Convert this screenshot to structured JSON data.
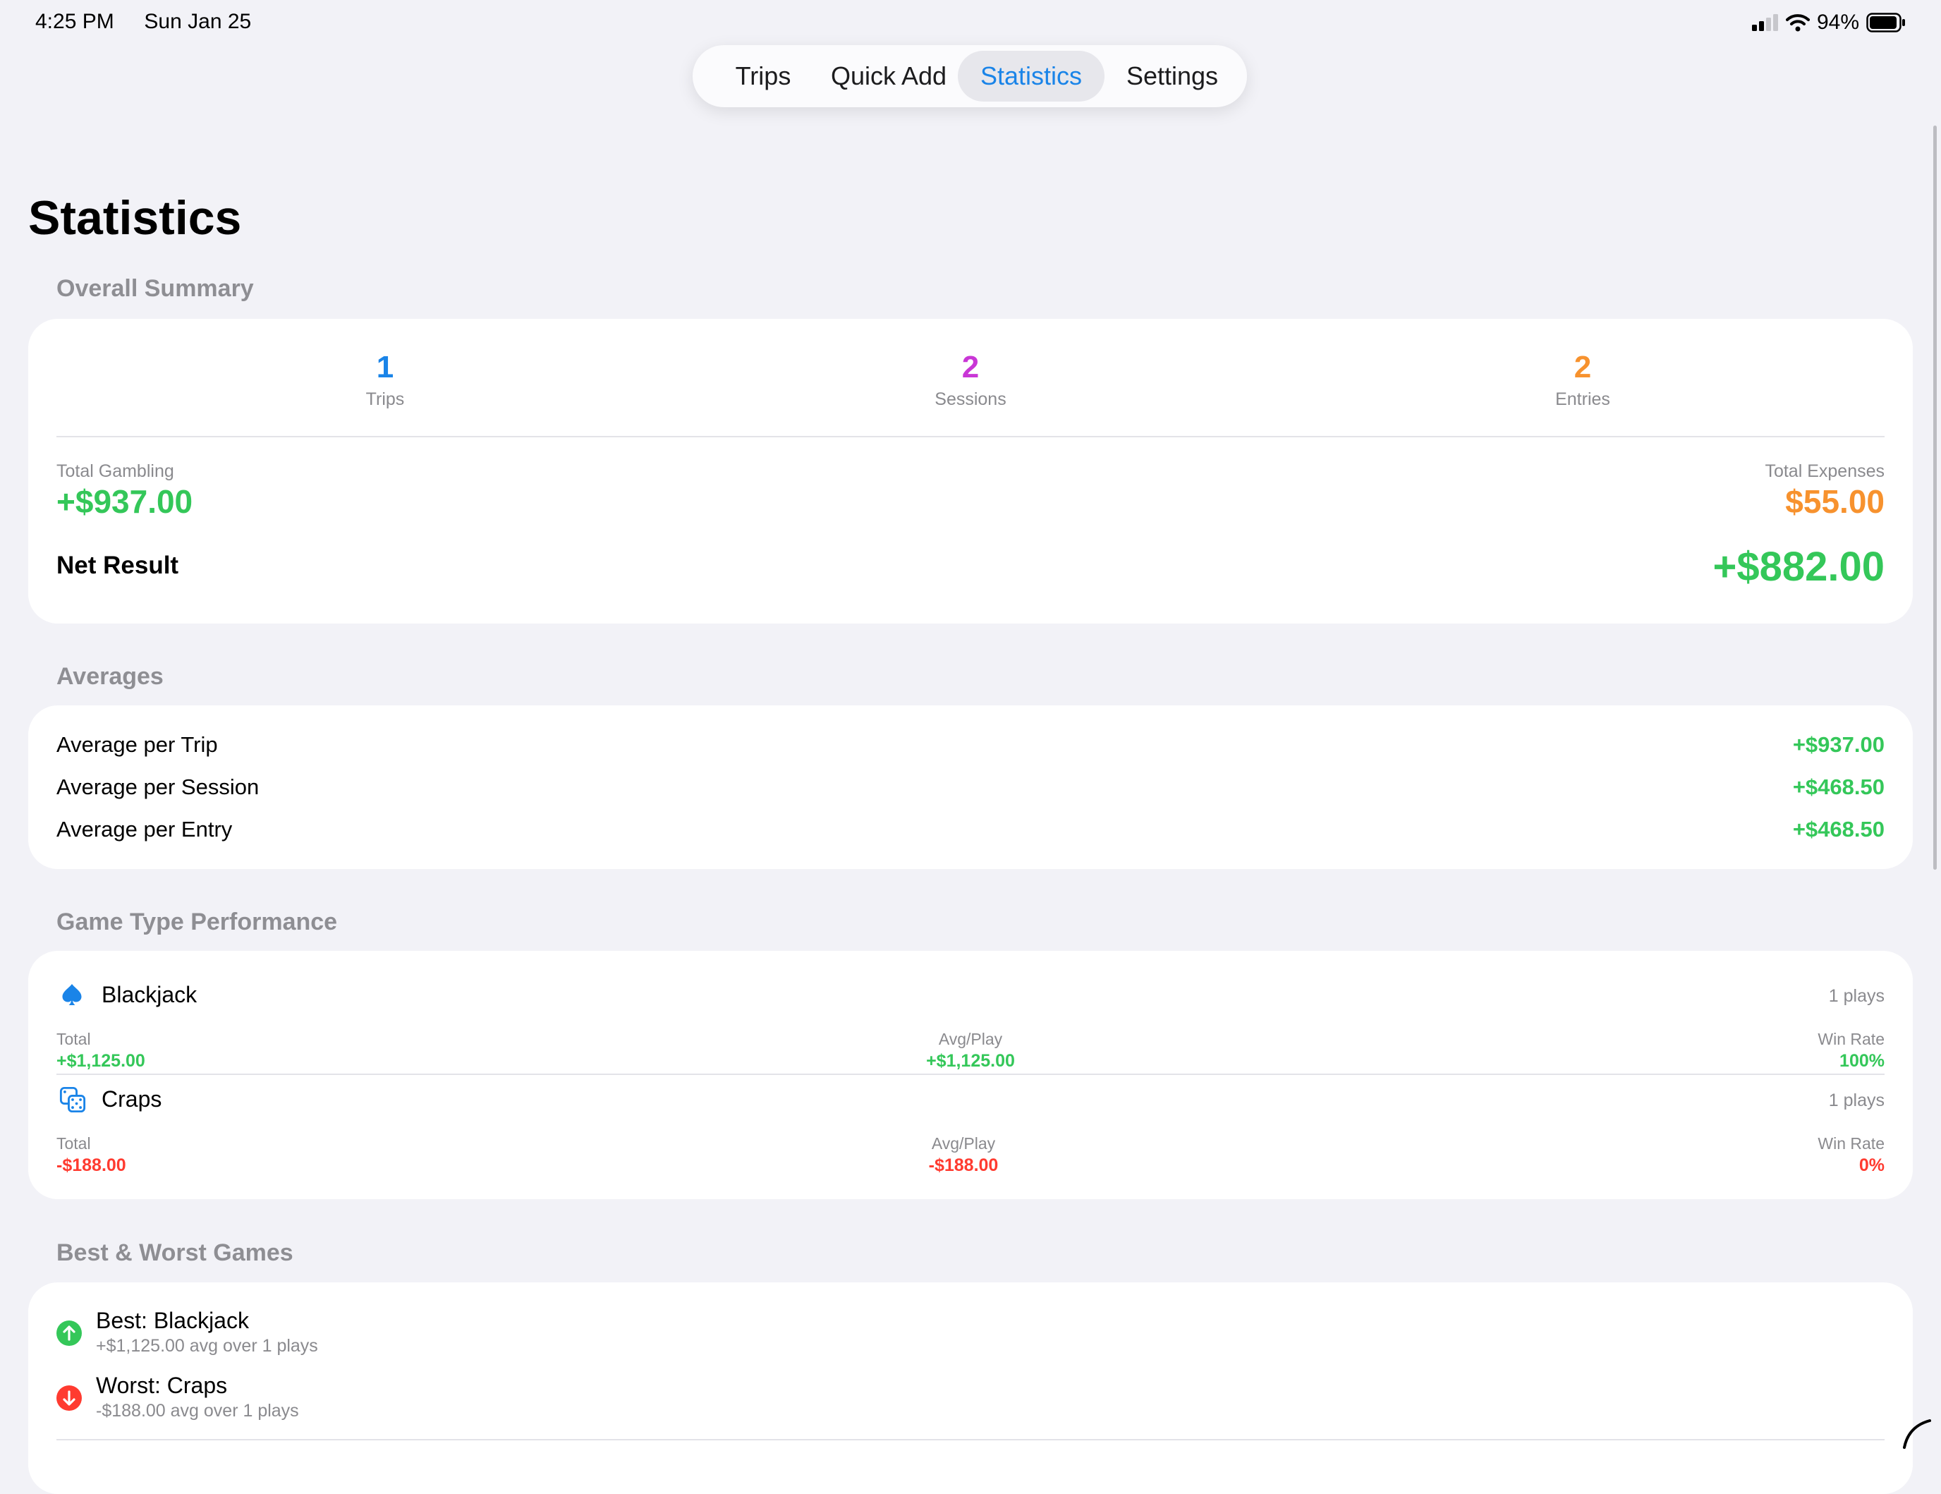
{
  "status": {
    "time": "4:25 PM",
    "date": "Sun Jan 25",
    "battery": "94%"
  },
  "nav": {
    "tabs": [
      "Trips",
      "Quick Add",
      "Statistics",
      "Settings"
    ],
    "active": "Statistics"
  },
  "page": {
    "title": "Statistics"
  },
  "summary": {
    "label": "Overall Summary",
    "counts": [
      {
        "value": "1",
        "label": "Trips",
        "color": "#1a84e8"
      },
      {
        "value": "2",
        "label": "Sessions",
        "color": "#c936d6"
      },
      {
        "value": "2",
        "label": "Entries",
        "color": "#f7922e"
      }
    ],
    "total_gambling_label": "Total Gambling",
    "total_gambling_value": "+$937.00",
    "total_expenses_label": "Total Expenses",
    "total_expenses_value": "$55.00",
    "net_label": "Net Result",
    "net_value": "+$882.00"
  },
  "averages": {
    "label": "Averages",
    "rows": [
      {
        "label": "Average per Trip",
        "value": "+$937.00"
      },
      {
        "label": "Average per Session",
        "value": "+$468.50"
      },
      {
        "label": "Average per Entry",
        "value": "+$468.50"
      }
    ]
  },
  "games": {
    "label": "Game Type Performance",
    "total_label": "Total",
    "avg_label": "Avg/Play",
    "winrate_label": "Win Rate",
    "items": [
      {
        "name": "Blackjack",
        "icon": "spade-icon",
        "plays": "1 plays",
        "total": "+$1,125.00",
        "avg": "+$1,125.00",
        "winrate": "100%",
        "positive": true
      },
      {
        "name": "Craps",
        "icon": "dice-icon",
        "plays": "1 plays",
        "total": "-$188.00",
        "avg": "-$188.00",
        "winrate": "0%",
        "positive": false
      }
    ]
  },
  "best_worst": {
    "label": "Best & Worst Games",
    "best_title": "Best: Blackjack",
    "best_sub": "+$1,125.00 avg over 1 plays",
    "worst_title": "Worst: Craps",
    "worst_sub": "-$188.00 avg over 1 plays"
  },
  "colors": {
    "accent": "#1a84e8",
    "positive": "#34c759",
    "negative": "#ff3b30",
    "expense": "#f7922e",
    "background": "#f2f2f7"
  }
}
